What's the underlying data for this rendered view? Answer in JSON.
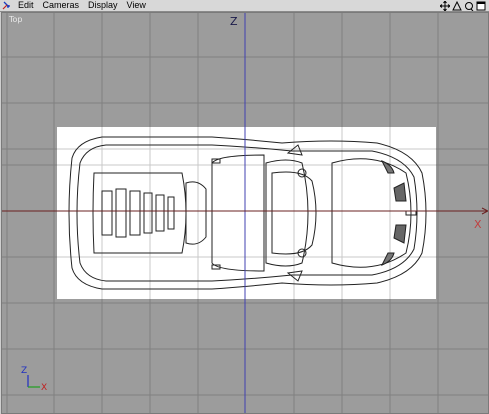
{
  "menubar": {
    "items": [
      "Edit",
      "Cameras",
      "Display",
      "View"
    ],
    "tools": [
      "move-view-icon",
      "zoom-view-icon",
      "rotate-view-icon",
      "maximize-view-icon"
    ]
  },
  "viewport": {
    "label": "Top",
    "axes": {
      "vertical": "Z",
      "horizontal": "X"
    },
    "gizmo": {
      "up": "Z",
      "right": "X"
    }
  },
  "colors": {
    "background": "#9c9c9c",
    "grid": "#808080",
    "z_axis": "#4040b0",
    "x_axis": "#6a2020",
    "blueprint": "#ffffff"
  }
}
